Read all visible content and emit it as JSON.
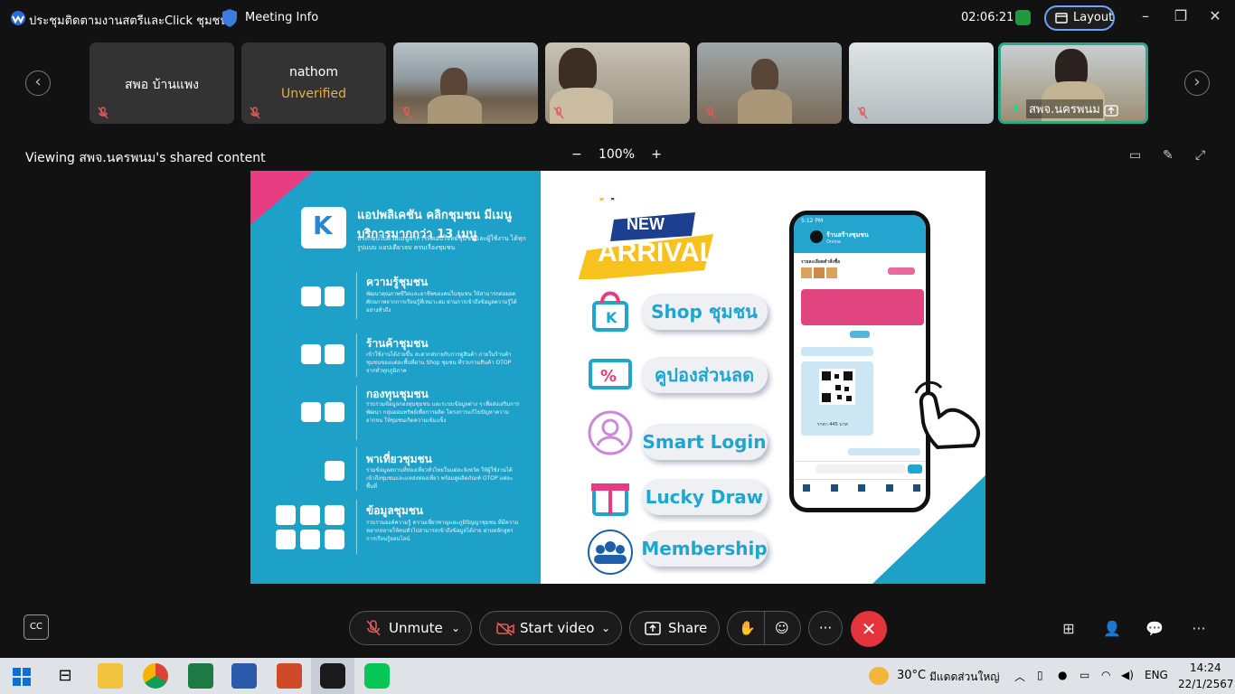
{
  "titlebar": {
    "app_title": "ประชุมติดตามงานสตรีและClick ชุมชน",
    "meeting_info": "Meeting Info",
    "timer": "02:06:21",
    "layout_label": "Layout"
  },
  "participants": [
    {
      "name": "สพอ บ้านแพง",
      "status": "",
      "video": false
    },
    {
      "name": "nathom",
      "status": "Unverified",
      "video": false
    },
    {
      "name": "",
      "status": "",
      "video": true
    },
    {
      "name": "",
      "status": "",
      "video": true
    },
    {
      "name": "",
      "status": "",
      "video": true
    },
    {
      "name": "",
      "status": "",
      "video": true
    },
    {
      "name": "สพจ.นครพนม",
      "status": "",
      "video": true,
      "active": true
    }
  ],
  "share": {
    "viewing_text": "Viewing สพจ.นครพนม's shared content",
    "zoom_level": "100%"
  },
  "slide": {
    "heading": "แอปพลิเคชัน คลิกชุมชน มีเมนูบริการมากกว่า 13 เมนู",
    "subheading": "ประกอบไปด้วยเมนูบริการที่ตอบโจทย์ชุมชนและผู้ใช้งาน ได้ทุกรูปแบบ แอปเดียวจบ ครบเรื่องชุมชน",
    "sections": [
      {
        "title": "ความรู้ชุมชน",
        "text": "พัฒนาคุณภาพชีวิตและอาชีพของคนในชุมชน ให้สามารถต่อยอด ศักยภาพจากการเรียนรู้ที่เหมาะสม ผ่านการเข้าถึงข้อมูลความรู้ได้อย่างทั่วถึง"
      },
      {
        "title": "ร้านค้าชุมชน",
        "text": "เข้าใช้งานได้ง่ายขึ้น สะดวกสบายกับการดูสินค้า ภายในร้านค้าชุมชนของแต่ละพื้นที่ผ่าน Shop ชุมชน ที่รวบรวมสินค้า OTOP จากทั่วทุกภูมิภาค"
      },
      {
        "title": "กองทุนชุมชน",
        "text": "รวบรวมข้อมูลกองทุนชุมชน และระบบข้อมูลต่าง ๆ เพื่อส่งเสริมการพัฒนา กลุ่มออมทรัพย์เพื่อการผลิต โครงการแก้ไขปัญหาความยากจน ให้ชุมชนเกิดความเข้มแข็ง"
      },
      {
        "title": "พาเที่ยวชุมชน",
        "text": "รวมข้อมูลสถานที่ท่องเที่ยวทั่วไทยในแต่ละจังหวัด ให้ผู้ใช้งานได้เข้าถึงชุมชนและแหล่งท่องเที่ยว พร้อมดูผลิตภัณฑ์ OTOP แต่ละพื้นที่"
      },
      {
        "title": "ข้อมูลชุมชน",
        "text": "รวบรวมองค์ความรู้ ความเชี่ยวชาญและภูมิปัญญาชุมชน ที่มีความหลากหลายให้คนทั่วไปสามารถเข้าถึงข้อมูลได้ง่าย ผ่านหลักสูตรการเรียนรู้ออนไลน์"
      }
    ],
    "banner_new": "NEW",
    "banner_arrival": "ARRIVAL",
    "features": [
      "Shop ชุมชน",
      "คูปองส่วนลด",
      "Smart Login",
      "Lucky Draw",
      "Membership"
    ],
    "phone": {
      "time": "5:12 PM",
      "shop_name": "ร้านสร้างชุมชน",
      "shop_status": "Online",
      "order_detail": "รายละเอียดคำสั่งซื้อ",
      "price": "ราคา 445 บาท"
    }
  },
  "controls": {
    "unmute": "Unmute",
    "start_video": "Start video",
    "share": "Share"
  },
  "taskbar": {
    "temperature": "30°C",
    "weather": "มีแดดส่วนใหญ่",
    "language": "ENG",
    "time": "14:24",
    "date": "22/1/2567"
  },
  "colors": {
    "accent": "#6ea3ff",
    "slide_blue": "#1da1c9",
    "slide_pink": "#e73c80",
    "end_red": "#e5343b",
    "active_green": "#2aa88a"
  }
}
